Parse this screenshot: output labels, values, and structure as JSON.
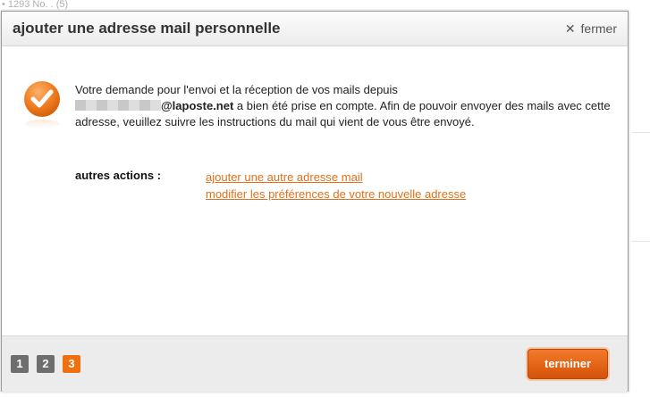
{
  "background": {
    "partial_text": "• 1293 No. . (5)"
  },
  "dialog": {
    "title": "ajouter une adresse mail personnelle",
    "close_label": "fermer",
    "close_icon": "close-icon",
    "status_icon": "success-check-icon",
    "message": {
      "line1": "Votre demande pour l'envoi et la réception de vos mails depuis",
      "email_domain": "@laposte.net",
      "rest": " a bien été prise en compte. Afin de pouvoir envoyer des mails avec cette adresse, veuillez suivre les instructions du mail qui vient de vous être envoyé."
    },
    "actions": {
      "label": "autres actions :",
      "links": [
        "ajouter une autre adresse mail",
        "modifier les préférences de votre nouvelle adresse"
      ]
    },
    "steps": {
      "items": [
        "1",
        "2",
        "3"
      ],
      "active": "3"
    },
    "finish_button": "terminer"
  },
  "colors": {
    "accent": "#f07010",
    "link": "#e0701a",
    "step_inactive": "#6e6e6e"
  }
}
